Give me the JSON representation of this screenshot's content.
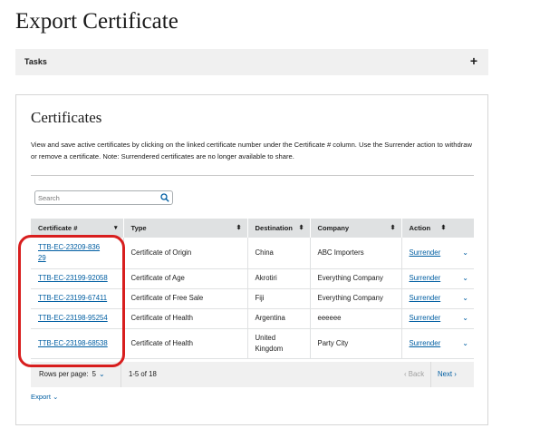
{
  "page": {
    "title": "Export Certificate"
  },
  "tasks": {
    "label": "Tasks",
    "toggle": "+"
  },
  "certificates": {
    "title": "Certificates",
    "description": "View and save active certificates by clicking on the linked certificate number under the Certificate # column. Use the Surrender action to withdraw or remove a certificate. Note: Surrendered certificates are no longer available to share.",
    "search_placeholder": "Search",
    "columns": [
      "Certificate #",
      "Type",
      "Destination",
      "Company",
      "Action"
    ],
    "rows": [
      {
        "cert": "TTB-EC-23209-83629",
        "type": "Certificate of Origin",
        "destination": "China",
        "company": "ABC Importers",
        "action": "Surrender"
      },
      {
        "cert": "TTB-EC-23199-92058",
        "type": "Certificate of Age",
        "destination": "Akrotiri",
        "company": "Everything Company",
        "action": "Surrender"
      },
      {
        "cert": "TTB-EC-23199-67411",
        "type": "Certificate of Free Sale",
        "destination": "Fiji",
        "company": "Everything Company",
        "action": "Surrender"
      },
      {
        "cert": "TTB-EC-23198-95254",
        "type": "Certificate of Health",
        "destination": "Argentina",
        "company": "eeeeee",
        "action": "Surrender"
      },
      {
        "cert": "TTB-EC-23198-68538",
        "type": "Certificate of Health",
        "destination": "United Kingdom",
        "company": "Party City",
        "action": "Surrender"
      }
    ],
    "pager": {
      "rows_per_page_label": "Rows per page:",
      "rows_per_page": "5",
      "range": "1-5 of 18",
      "back": "Back",
      "next": "Next"
    },
    "export_label": "Export"
  },
  "colors": {
    "link": "#005ea2",
    "header_bg": "#dfe1e2",
    "highlight": "#d81e1e"
  }
}
